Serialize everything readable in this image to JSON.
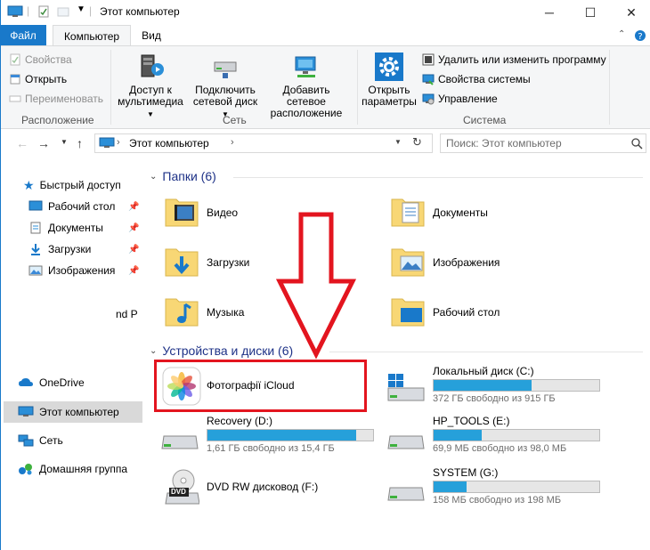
{
  "window": {
    "title": "Этот компьютер",
    "minimize": "─",
    "maximize": "☐",
    "close": "✕"
  },
  "ribbon_tabs": {
    "file": "Файл",
    "computer": "Компьютер",
    "view": "Вид"
  },
  "ribbon": {
    "location": {
      "properties": "Свойства",
      "open": "Открыть",
      "rename": "Переименовать",
      "label": "Расположение"
    },
    "network": {
      "media_access_1": "Доступ к",
      "media_access_2": "мультимедиа",
      "map_drive_1": "Подключить",
      "map_drive_2": "сетевой диск",
      "add_location_1": "Добавить сетевое",
      "add_location_2": "расположение",
      "label": "Сеть"
    },
    "system": {
      "open_settings_1": "Открыть",
      "open_settings_2": "параметры",
      "uninstall": "Удалить или изменить программу",
      "system_properties": "Свойства системы",
      "manage": "Управление",
      "label": "Система"
    }
  },
  "address_bar": {
    "path": "Этот компьютер",
    "search_placeholder": "Поиск: Этот компьютер"
  },
  "nav_pane": {
    "quick_access": "Быстрый доступ",
    "items": [
      {
        "label": "Рабочий стол"
      },
      {
        "label": "Документы"
      },
      {
        "label": "Загрузки"
      },
      {
        "label": "Изображения"
      }
    ],
    "truncated": "nd P",
    "onedrive": "OneDrive",
    "this_pc": "Этот компьютер",
    "network": "Сеть",
    "homegroup": "Домашняя группа"
  },
  "folders": {
    "header": "Папки (6)",
    "items": [
      {
        "label": "Видео"
      },
      {
        "label": "Документы"
      },
      {
        "label": "Загрузки"
      },
      {
        "label": "Изображения"
      },
      {
        "label": "Музыка"
      },
      {
        "label": "Рабочий стол"
      }
    ]
  },
  "devices": {
    "header": "Устройства и диски (6)",
    "icloud": "Фотографії iCloud",
    "drives": [
      {
        "name": "Локальный диск (C:)",
        "free": "372 ГБ свободно из 915 ГБ",
        "used_fraction": 0.59
      },
      {
        "name": "Recovery (D:)",
        "free": "1,61 ГБ свободно из 15,4 ГБ",
        "used_fraction": 0.9
      },
      {
        "name": "HP_TOOLS (E:)",
        "free": "69,9 МБ свободно из 98,0 МБ",
        "used_fraction": 0.29
      },
      {
        "name": "DVD RW дисковод (F:)",
        "free": "",
        "used_fraction": null
      },
      {
        "name": "SYSTEM (G:)",
        "free": "158 МБ свободно из 198 МБ",
        "used_fraction": 0.2
      }
    ],
    "dvd_badge": "DVD"
  },
  "colors": {
    "accent": "#1979ca",
    "drive_bar": "#26a0da",
    "annotation": "#e3151f",
    "folder": "#f8d775"
  }
}
